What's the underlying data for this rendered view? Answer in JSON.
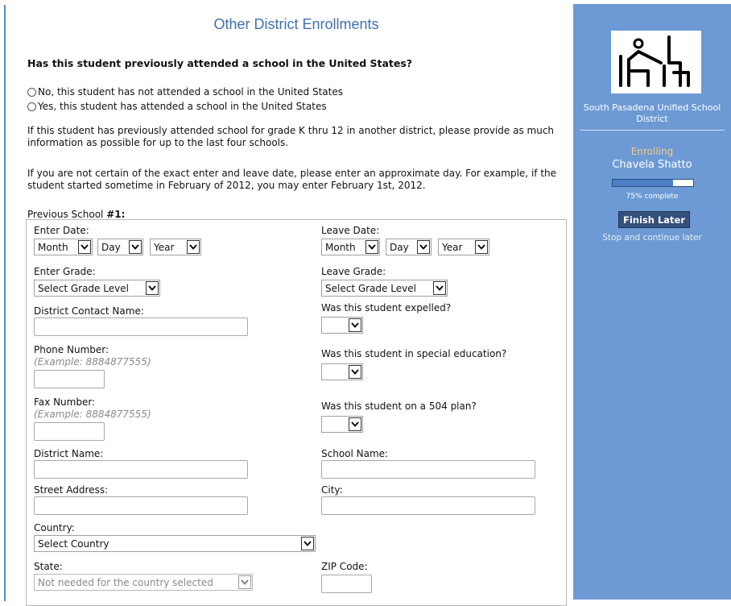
{
  "page": {
    "title": "Other District Enrollments",
    "question": "Has this student previously attended a school in the United States?",
    "radio_options": [
      "No, this student has not attended a school in the United States",
      "Yes, this student has attended a school in the United States"
    ],
    "info_paragraph_1": "If this student has previously attended school for grade K thru 12 in another district, please provide as much information as possible for up to the last four schools.",
    "info_paragraph_2": "If you are not certain of the exact enter and leave date, please enter an approximate day. For example, if the student started sometime in February of 2012, you may enter February 1st, 2012.",
    "previous_school_prefix": "Previous School ",
    "previous_school_number": "#1:"
  },
  "form": {
    "enter_date_label": "Enter Date:",
    "leave_date_label": "Leave Date:",
    "month": "Month",
    "day": "Day",
    "year": "Year",
    "enter_grade_label": "Enter Grade:",
    "leave_grade_label": "Leave Grade:",
    "grade_placeholder": "Select Grade Level",
    "district_contact_label": "District Contact Name:",
    "expelled_label": "Was this student expelled?",
    "phone_label": "Phone Number:",
    "phone_hint": "(Example: 8884877555)",
    "special_ed_label": "Was this student in special education?",
    "fax_label": "Fax Number:",
    "fax_hint": "(Example: 8884877555)",
    "plan504_label": "Was this student on a 504 plan?",
    "district_name_label": "District Name:",
    "school_name_label": "School Name:",
    "street_label": "Street Address:",
    "city_label": "City:",
    "country_label": "Country:",
    "country_placeholder": "Select Country",
    "state_label": "State:",
    "state_placeholder": "Not needed for the country selected",
    "zip_label": "ZIP Code:"
  },
  "sidebar": {
    "logo_icon": "student-at-desk-icon",
    "district_name": "South Pasadena Unified School District",
    "status": "Enrolling",
    "student_name": "Chavela Shatto",
    "progress_fraction": 0.75,
    "progress_text": "75% complete",
    "finish_button": "Finish Later",
    "finish_caption": "Stop and continue later"
  },
  "colors": {
    "title_blue": "#3f6fae",
    "sidebar_blue": "#6d9ad4",
    "button_navy": "#34507c",
    "status_orange": "#f3c98a"
  }
}
